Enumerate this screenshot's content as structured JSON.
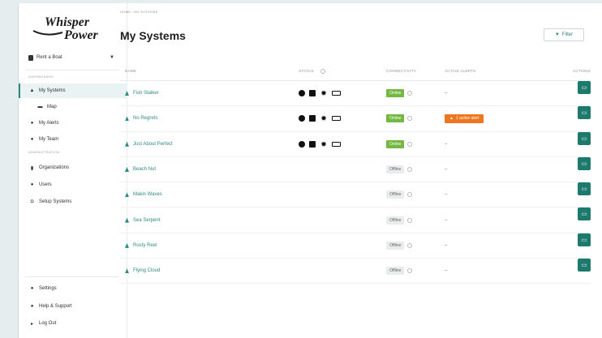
{
  "brand": {
    "name_line1": "Whisper",
    "name_line2": "Power"
  },
  "boat_selector": {
    "label": "Rent a Boat"
  },
  "sidebar": {
    "section_dashboards": "DASHBOARDS",
    "section_administration": "ADMINISTRATION",
    "items": [
      {
        "label": "My Systems",
        "icon": "boat-icon",
        "glyph": "▲"
      },
      {
        "label": "Map",
        "icon": "map-icon",
        "glyph": "▬"
      },
      {
        "label": "My Alerts",
        "icon": "bell-icon",
        "glyph": "●"
      },
      {
        "label": "My Team",
        "icon": "team-icon",
        "glyph": "●"
      }
    ],
    "admin_items": [
      {
        "label": "Organizations",
        "icon": "building-icon",
        "glyph": "▮"
      },
      {
        "label": "Users",
        "icon": "users-icon",
        "glyph": "●"
      },
      {
        "label": "Setup Systems",
        "icon": "setup-icon",
        "glyph": "◘"
      }
    ],
    "footer_items": [
      {
        "label": "Settings",
        "icon": "gear-icon",
        "glyph": "●"
      },
      {
        "label": "Help & Support",
        "icon": "help-icon",
        "glyph": "●"
      },
      {
        "label": "Log Out",
        "icon": "logout-icon",
        "glyph": "▸"
      }
    ]
  },
  "breadcrumb": "HOME / MY SYSTEMS",
  "page": {
    "title": "My Systems"
  },
  "filter": {
    "label": "Filter"
  },
  "table": {
    "headers": {
      "name": "NAME",
      "status": "STATUS",
      "connectivity": "CONNECTIVITY",
      "active_alerts": "ACTIVE ALERTS",
      "actions": "ACTIONS"
    },
    "rows": [
      {
        "name": "Fish Stalker",
        "has_status": true,
        "connectivity": "Online",
        "alert": "–"
      },
      {
        "name": "No Regrets",
        "has_status": true,
        "connectivity": "Online",
        "alert": "1 active alert"
      },
      {
        "name": "Just About Perfect",
        "has_status": true,
        "connectivity": "Online",
        "alert": "–"
      },
      {
        "name": "Beach Nut",
        "has_status": false,
        "connectivity": "Offline",
        "alert": "–"
      },
      {
        "name": "Makin Waves",
        "has_status": false,
        "connectivity": "Offline",
        "alert": "–"
      },
      {
        "name": "Sea Serpent",
        "has_status": false,
        "connectivity": "Offline",
        "alert": "–"
      },
      {
        "name": "Rusty Reel",
        "has_status": false,
        "connectivity": "Offline",
        "alert": "–"
      },
      {
        "name": "Flying Cloud",
        "has_status": false,
        "connectivity": "Offline",
        "alert": "–"
      }
    ]
  },
  "colors": {
    "accent": "#2d8a83",
    "online": "#74b843",
    "alert": "#ef7620",
    "action": "#1f7a6e"
  }
}
